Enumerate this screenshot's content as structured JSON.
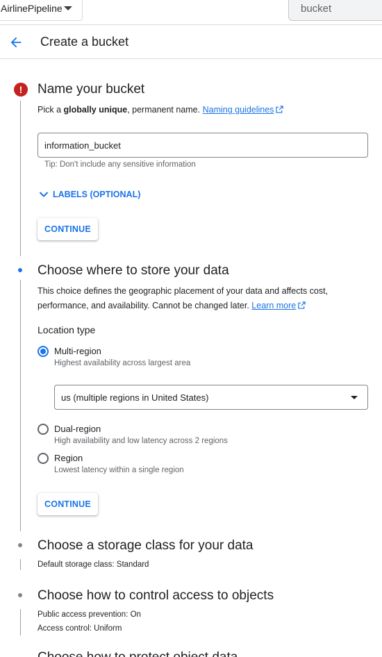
{
  "topbar": {
    "project_name": "AirlinePipeline",
    "search_value": "bucket"
  },
  "header": {
    "title": "Create a bucket"
  },
  "step1": {
    "heading": "Name your bucket",
    "desc_prefix": "Pick a ",
    "desc_bold": "globally unique",
    "desc_suffix": ", permanent name. ",
    "naming_link": "Naming guidelines",
    "input_value": "information_bucket",
    "tip": "Tip: Don't include any sensitive information",
    "labels_toggle": "LABELS (OPTIONAL)",
    "continue": "CONTINUE"
  },
  "step2": {
    "heading": "Choose where to store your data",
    "desc_line1": "This choice defines the geographic placement of your data and affects cost,",
    "desc_line2": "performance, and availability. Cannot be changed later. ",
    "learn_more": "Learn more",
    "location_type_label": "Location type",
    "options": [
      {
        "label": "Multi-region",
        "desc": "Highest availability across largest area",
        "selected": true
      },
      {
        "label": "Dual-region",
        "desc": "High availability and low latency across 2 regions",
        "selected": false
      },
      {
        "label": "Region",
        "desc": "Lowest latency within a single region",
        "selected": false
      }
    ],
    "select_value": "us (multiple regions in United States)",
    "continue": "CONTINUE"
  },
  "step3": {
    "heading": "Choose a storage class for your data",
    "detail_label": "Default storage class",
    "detail_value": ": Standard"
  },
  "step4": {
    "heading": "Choose how to control access to objects",
    "detail1_label": "Public access prevention",
    "detail1_value": ": On",
    "detail2_label": "Access control",
    "detail2_value": ": Uniform"
  },
  "step5": {
    "heading_partial": "Choose how to protect object data"
  },
  "colors": {
    "accent": "#1a73e8",
    "error": "#c5221f",
    "text": "#202124",
    "muted": "#5f6368"
  }
}
